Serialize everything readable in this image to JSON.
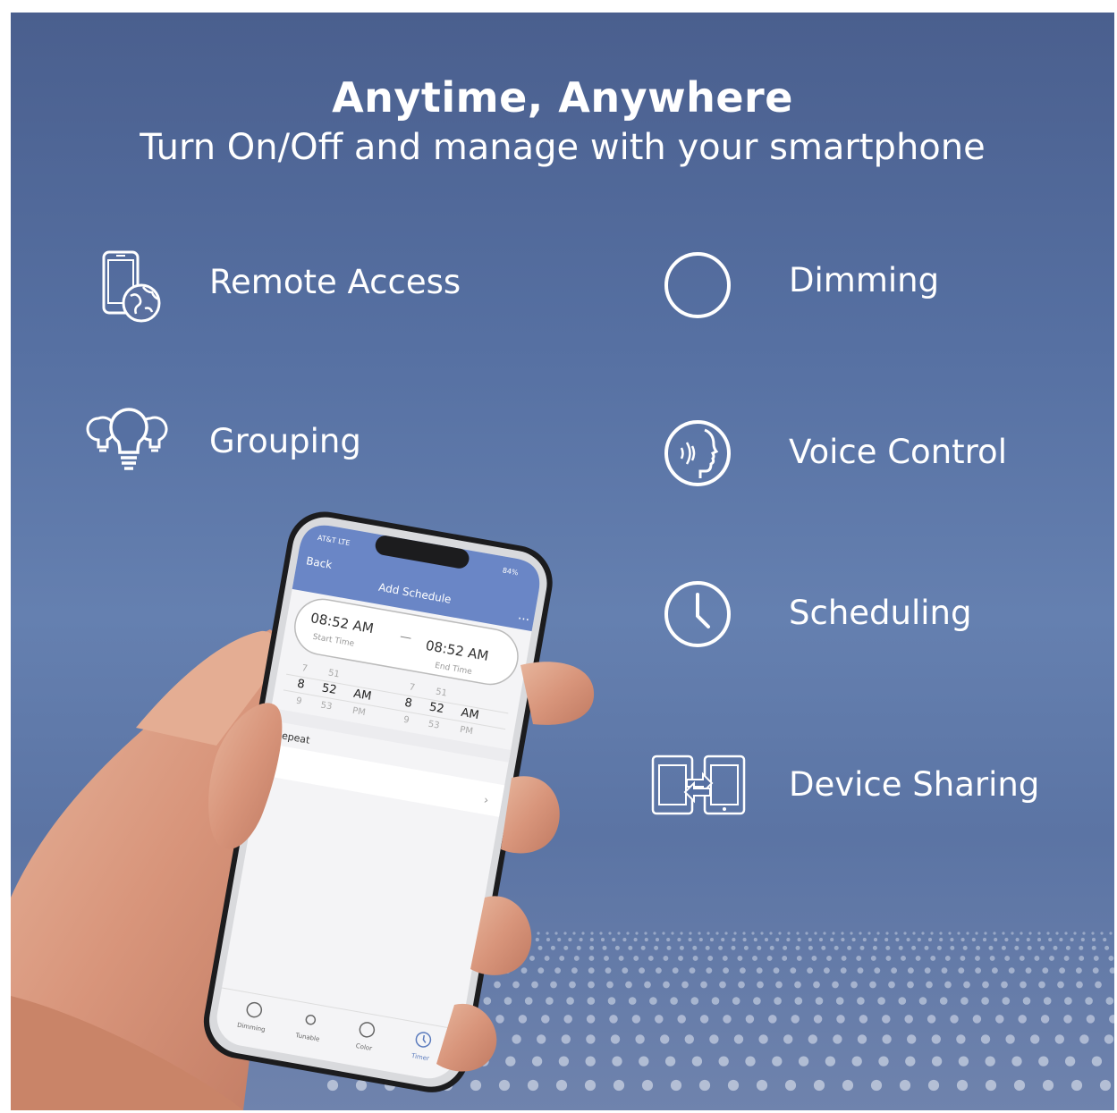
{
  "title": "Anytime, Anywhere",
  "subtitle": "Turn On/Off and manage with your smartphone",
  "features": [
    {
      "label": "Remote Access",
      "icon": "phone-globe-icon"
    },
    {
      "label": "Dimming",
      "icon": "dimming-circle-icon"
    },
    {
      "label": "Grouping",
      "icon": "bulbs-group-icon"
    },
    {
      "label": "Voice Control",
      "icon": "voice-face-icon"
    },
    {
      "label": "Scheduling",
      "icon": "clock-icon"
    },
    {
      "label": "Device Sharing",
      "icon": "device-share-icon"
    }
  ],
  "phone": {
    "status_carrier": "AT&T LTE",
    "status_battery": "84%",
    "back_label": "Back",
    "header_title": "Add Schedule",
    "more_label": "...",
    "start_time": "08:52 AM",
    "start_label": "Start Time",
    "dash": "—",
    "end_time": "08:52 AM",
    "end_label": "End Time",
    "picker_start": {
      "hour": [
        "7",
        "8",
        "9"
      ],
      "minute": [
        "51",
        "52",
        "53"
      ],
      "ampm": [
        "AM",
        "PM"
      ]
    },
    "picker_end": {
      "hour": [
        "7",
        "8",
        "9"
      ],
      "minute": [
        "51",
        "52",
        "53"
      ],
      "ampm": [
        "AM",
        "PM"
      ]
    },
    "repeat_label": "Repeat",
    "chevron": "›",
    "tabs": [
      "Dimming",
      "Tunable",
      "Color",
      "Timer"
    ]
  },
  "colors": {
    "accent": "#5b7bbd",
    "background": "#5670a2"
  }
}
